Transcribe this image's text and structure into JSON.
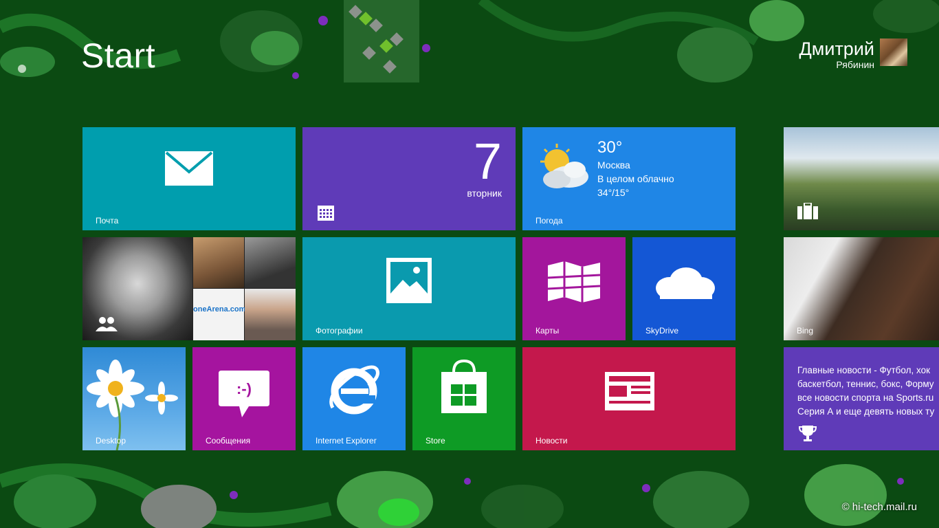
{
  "screen": {
    "title": "Start"
  },
  "user": {
    "first_name": "Дмитрий",
    "last_name": "Рябинин"
  },
  "tiles": {
    "mail": {
      "label": "Почта",
      "icon": "mail-icon"
    },
    "calendar": {
      "day": "7",
      "weekday": "вторник",
      "icon": "calendar-icon"
    },
    "weather": {
      "label": "Погода",
      "temp": "30°",
      "city": "Москва",
      "condition": "В целом облачно",
      "range": "34°/15°",
      "icon": "partly-cloudy-icon"
    },
    "travel": {
      "icon": "suitcase-icon"
    },
    "people": {
      "icon": "people-icon",
      "arena_text": "oneArena.com"
    },
    "photos": {
      "label": "Фотографии",
      "icon": "photos-icon"
    },
    "maps": {
      "label": "Карты",
      "icon": "map-icon"
    },
    "skydrive": {
      "label": "SkyDrive",
      "icon": "cloud-icon"
    },
    "bing": {
      "label": "Bing"
    },
    "desktop": {
      "label": "Desktop"
    },
    "messages": {
      "label": "Сообщения",
      "icon": "chat-bubble-icon",
      "emoticon": ":-)"
    },
    "ie": {
      "label": "Internet Explorer",
      "icon": "ie-icon"
    },
    "store": {
      "label": "Store",
      "icon": "store-bag-icon"
    },
    "news": {
      "label": "Новости",
      "icon": "newspaper-icon"
    },
    "sports": {
      "lines": [
        "Главные новости - Футбол, хок",
        "баскетбол, теннис, бокс, Форму",
        "все новости спорта на Sports.ru",
        "Серия А и еще девять новых ту"
      ],
      "icon": "trophy-icon"
    }
  },
  "watermark": "© hi-tech.mail.ru",
  "colors": {
    "background": "#0b4a12",
    "mail": "#009eae",
    "calendar": "#5f3bb8",
    "weather": "#1f86e6",
    "photos": "#0a9aae",
    "maps": "#a3169c",
    "skydrive": "#1457d5",
    "messages": "#a5149f",
    "ie": "#1f86e6",
    "store": "#0e9b25",
    "news": "#c4184c",
    "sports": "#5f3bb8"
  }
}
